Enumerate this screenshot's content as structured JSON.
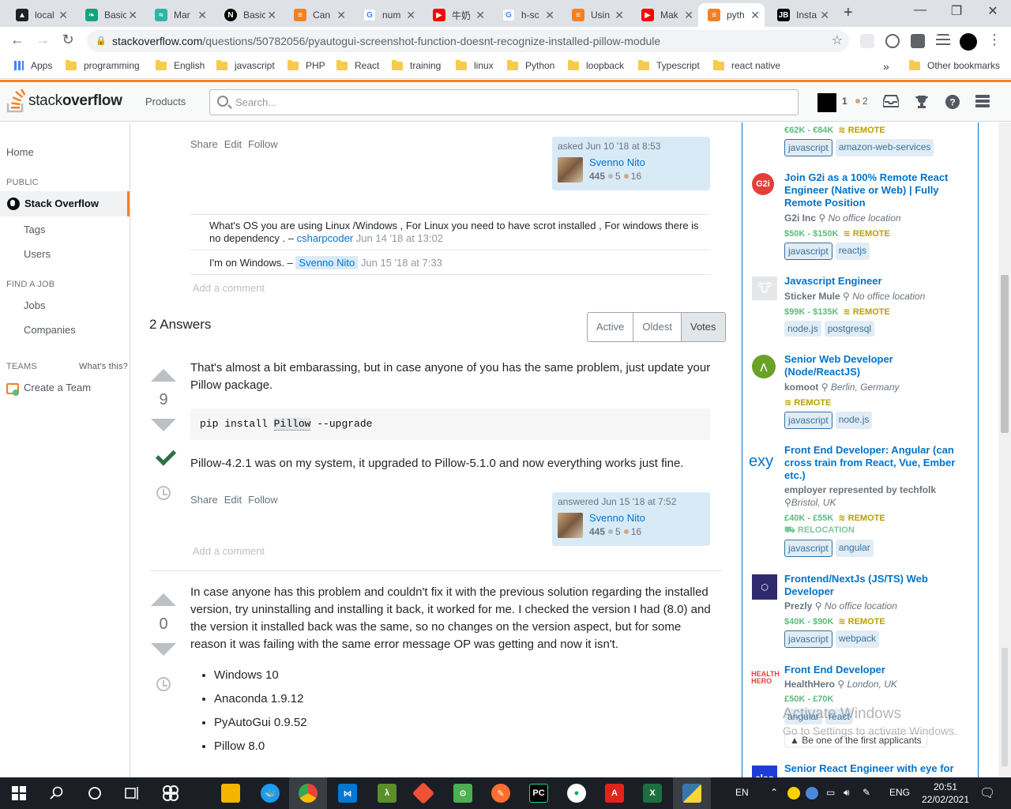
{
  "browser": {
    "tabs": [
      {
        "label": "local",
        "icon": "drive-icon",
        "color": "#202124"
      },
      {
        "label": "Basic",
        "icon": "leaf-icon",
        "color": "#16a37c"
      },
      {
        "label": "Mar",
        "icon": "wave-icon",
        "color": "#2fb5a6"
      },
      {
        "label": "Basic",
        "icon": "notion-icon",
        "color": "#000000"
      },
      {
        "label": "Can",
        "icon": "stackoverflow-icon",
        "color": "#f48024"
      },
      {
        "label": "num",
        "icon": "google-icon",
        "color": "#4285f4"
      },
      {
        "label": "牛奶",
        "icon": "youtube-icon",
        "color": "#ff0000"
      },
      {
        "label": "h-sc",
        "icon": "google-icon",
        "color": "#4285f4"
      },
      {
        "label": "Usin",
        "icon": "stackoverflow-icon",
        "color": "#f48024"
      },
      {
        "label": "Mak",
        "icon": "youtube-icon",
        "color": "#ff0000"
      },
      {
        "label": "pyth",
        "icon": "stackoverflow-icon",
        "color": "#f48024"
      },
      {
        "label": "Insta",
        "icon": "jetbrains-icon",
        "color": "#000000"
      }
    ],
    "url_domain": "stackoverflow.com",
    "url_path": "/questions/50782056/pyautogui-screenshot-function-doesnt-recognize-installed-pillow-module",
    "bookmarks": [
      "Apps",
      "programming",
      "English",
      "javascript",
      "PHP",
      "React",
      "training",
      "linux",
      "Python",
      "loopback",
      "Typescript",
      "react native"
    ],
    "more_bookmarks": "»",
    "other_bookmarks": "Other bookmarks"
  },
  "so_header": {
    "logo_light": "stack",
    "logo_bold": "overflow",
    "products": "Products",
    "search_placeholder": "Search...",
    "reputation": "1",
    "bronze": "2"
  },
  "leftnav": {
    "home": "Home",
    "public": "PUBLIC",
    "stack_overflow": "Stack Overflow",
    "tags": "Tags",
    "users": "Users",
    "find_job": "FIND A JOB",
    "jobs": "Jobs",
    "companies": "Companies",
    "teams": "TEAMS",
    "whats_this": "What's this?",
    "create_team": "Create a Team"
  },
  "question": {
    "menu": [
      "Share",
      "Edit",
      "Follow"
    ],
    "asked": "asked Jun 10 '18 at 8:53",
    "user": "Svenno Nito",
    "rep": "445",
    "silver": "5",
    "bronze": "16",
    "comments": [
      {
        "text": "What's OS you are using Linux /Windows , For Linux you need to have scrot installed , For windows there is no dependency . – ",
        "user": "csharpcoder",
        "date": "Jun 14 '18 at 13:02"
      },
      {
        "text": "I'm on Windows. – ",
        "user": "Svenno Nito",
        "date": "Jun 15 '18 at 7:33"
      }
    ],
    "add_comment": "Add a comment"
  },
  "answers": {
    "heading": "2 Answers",
    "sort": [
      "Active",
      "Oldest",
      "Votes"
    ],
    "a1": {
      "votes": "9",
      "text1": "That's almost a bit embarassing, but in case anyone of you has the same problem, just update your Pillow package.",
      "code_pre": "pip install ",
      "code_mark": "Pillow",
      "code_post": " --upgrade",
      "text2": "Pillow-4.2.1 was on my system, it upgraded to Pillow-5.1.0 and now everything works just fine.",
      "menu": [
        "Share",
        "Edit",
        "Follow"
      ],
      "answered": "answered Jun 15 '18 at 7:52",
      "user": "Svenno Nito",
      "rep": "445",
      "silver": "5",
      "bronze": "16",
      "add_comment": "Add a comment"
    },
    "a2": {
      "votes": "0",
      "text": "In case anyone has this problem and couldn't fix it with the previous solution regarding the installed version, try uninstalling and installing it back, it worked for me. I checked the version I had (8.0) and the version it installed back was the same, so no changes on the version aspect, but for some reason it was failing with the same error message OP was getting and now it isn't.",
      "bullets": [
        "Windows 10",
        "Anaconda 1.9.12",
        "PyAutoGui 0.9.52",
        "Pillow 8.0"
      ]
    }
  },
  "jobs": {
    "top": {
      "salary": "€62K - €84K",
      "remote": "REMOTE",
      "tags": [
        "javascript",
        "amazon-web-services"
      ]
    },
    "list": [
      {
        "title": "Join G2i as a 100% Remote React Engineer (Native or Web) | Fully Remote Position",
        "company": "G2i Inc",
        "location": "No office location",
        "salary": "$50K - $150K",
        "remote": "REMOTE",
        "tags": [
          "javascript",
          "reactjs"
        ],
        "logo": "G2i",
        "logo_color": "#e4403a"
      },
      {
        "title": "Javascript Engineer",
        "company": "Sticker Mule",
        "location": "No office location",
        "salary": "$99K - $135K",
        "remote": "REMOTE",
        "tags": [
          "node.js",
          "postgresql"
        ],
        "logo": "🐮",
        "logo_color": "#e4e6e8"
      },
      {
        "title": "Senior Web Developer (Node/ReactJS)",
        "company": "komoot",
        "location": "Berlin, Germany",
        "salary": "",
        "remote": "REMOTE",
        "tags": [
          "javascript",
          "node.js"
        ],
        "logo": "",
        "logo_color": "#6aa127"
      },
      {
        "title": "Front End Developer: Angular (can cross train from React, Vue, Ember etc.)",
        "company": "employer represented by techfolk",
        "location": "Bristol, UK",
        "salary": "£40K - £55K",
        "remote": "REMOTE",
        "relocation": "RELOCATION",
        "tags": [
          "javascript",
          "angular"
        ],
        "logo": "exy",
        "logo_color": "#ffffff"
      },
      {
        "title": "Frontend/NextJs (JS/TS) Web Developer",
        "company": "Prezly",
        "location": "No office location",
        "salary": "$40K - $90K",
        "remote": "REMOTE",
        "tags": [
          "javascript",
          "webpack"
        ],
        "logo": "P",
        "logo_color": "#2f2a6e"
      },
      {
        "title": "Front End Developer",
        "company": "HealthHero",
        "location": "London, UK",
        "salary": "£50K - £70K",
        "remote": "",
        "tags": [
          "angular",
          "react"
        ],
        "applicants": "Be one of the first applicants",
        "logo": "HEALTH HERO",
        "logo_color": "#ffffff"
      },
      {
        "title": "Senior React Engineer with eye for",
        "logo": "cleo",
        "logo_color": "#1d3cd6"
      }
    ]
  },
  "watermark": {
    "line1": "Activate Windows",
    "line2": "Go to Settings to activate Windows."
  },
  "taskbar": {
    "lang": "EN",
    "lang2": "ENG",
    "time": "20:51",
    "date": "22/02/2021"
  }
}
